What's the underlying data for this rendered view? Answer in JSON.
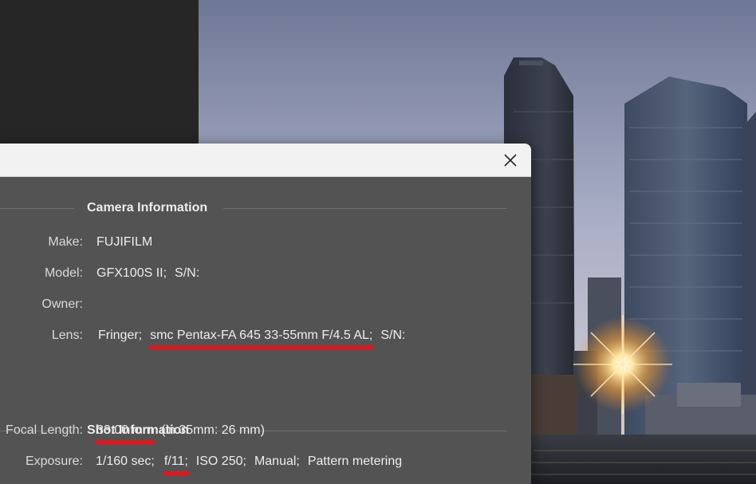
{
  "dialog": {
    "close_icon": "close-icon",
    "camera_section": {
      "title": "Camera Information",
      "make_label": "Make:",
      "make_value": "FUJIFILM",
      "model_label": "Model:",
      "model_value": "GFX100S II;",
      "model_sn": "S/N:",
      "owner_label": "Owner:",
      "lens_label": "Lens:",
      "lens_brand": "Fringer;",
      "lens_name": "smc Pentax-FA 645 33-55mm F/4.5 AL;",
      "lens_sn": "S/N:"
    },
    "shot_section": {
      "title": "Shot Information",
      "focal_label": "Focal Length:",
      "focal_value": "33.00 mm",
      "focal_35": "(in 35mm: 26 mm)",
      "exposure_label": "Exposure:",
      "exposure_shutter": "1/160 sec;",
      "exposure_aperture": "f/11;",
      "exposure_iso": "ISO 250;",
      "exposure_mode": "Manual;",
      "exposure_metering": "Pattern metering"
    }
  },
  "colors": {
    "dialog_bg": "#535353",
    "titlebar_bg": "#f2f2f2",
    "highlight_red": "#e8141b"
  }
}
